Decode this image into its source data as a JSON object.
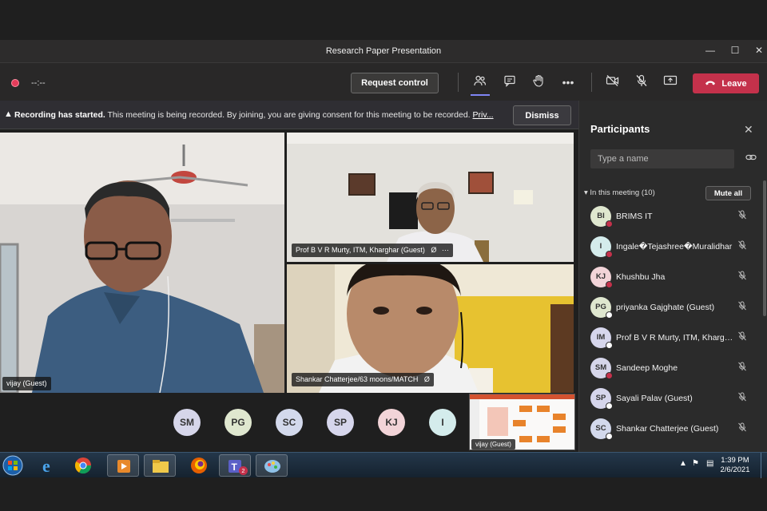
{
  "window": {
    "title": "Research Paper Presentation",
    "minimize_icon": "minimize-icon",
    "maximize_icon": "maximize-icon",
    "close_icon": "close-icon"
  },
  "toolbar": {
    "timer": "--:--",
    "request_control_label": "Request control",
    "leave_label": "Leave",
    "leave_color": "#c4314b",
    "icons": [
      "participants-icon",
      "chat-icon",
      "raise-hand-icon",
      "more-icon",
      "camera-off-icon",
      "mic-off-icon",
      "share-icon",
      "phone-icon"
    ]
  },
  "banner": {
    "bold": "Recording has started.",
    "text": " This meeting is being recorded. By joining, you are giving consent for this meeting to be recorded. ",
    "link": "Priv...",
    "dismiss_label": "Dismiss"
  },
  "videos": [
    {
      "name": "vijay (Guest)"
    },
    {
      "name": "Prof B V R Murty, ITM, Kharghar (Guest)",
      "more": "···"
    },
    {
      "name": "Shankar Chatterjee/63 moons/MATCH"
    },
    {
      "name": "vijay (Guest)"
    }
  ],
  "avatar_row": [
    {
      "initials": "SM",
      "color": "#d6d6ea"
    },
    {
      "initials": "PG",
      "color": "#dfe7cf"
    },
    {
      "initials": "SC",
      "color": "#d3d9ec"
    },
    {
      "initials": "SP",
      "color": "#d6d6ec"
    },
    {
      "initials": "KJ",
      "color": "#f2d4d8"
    },
    {
      "initials": "I",
      "color": "#d4ecec"
    }
  ],
  "participants": {
    "title": "Participants",
    "search_placeholder": "Type a name",
    "section_label": "In this meeting (10)",
    "mute_all_label": "Mute all",
    "list": [
      {
        "initials": "BI",
        "name": "BRIMS IT",
        "color": "#dfe7cf",
        "status": "#c4314b"
      },
      {
        "initials": "I",
        "name": "Ingale�Tejashree�Muralidhar",
        "color": "#d4ecec",
        "status": "#c4314b"
      },
      {
        "initials": "KJ",
        "name": "Khushbu Jha",
        "color": "#f2d4d8",
        "status": "#c4314b"
      },
      {
        "initials": "PG",
        "name": "priyanka Gajghate (Guest)",
        "color": "#dfe7cf",
        "status": "#ffffff"
      },
      {
        "initials": "IM",
        "name": "Prof B V R Murty, ITM, Khargh...",
        "color": "#d6d6ec",
        "status": "#ffffff"
      },
      {
        "initials": "SM",
        "name": "Sandeep Moghe",
        "color": "#d6d6ea",
        "status": "#c4314b"
      },
      {
        "initials": "SP",
        "name": "Sayali Palav (Guest)",
        "color": "#d6d6ec",
        "status": "#ffffff"
      },
      {
        "initials": "SC",
        "name": "Shankar Chatterjee (Guest)",
        "color": "#d3d9ec",
        "status": "#ffffff"
      }
    ]
  },
  "taskbar": {
    "time": "1:39 PM",
    "date": "2/6/2021",
    "teams_badge": "2"
  }
}
